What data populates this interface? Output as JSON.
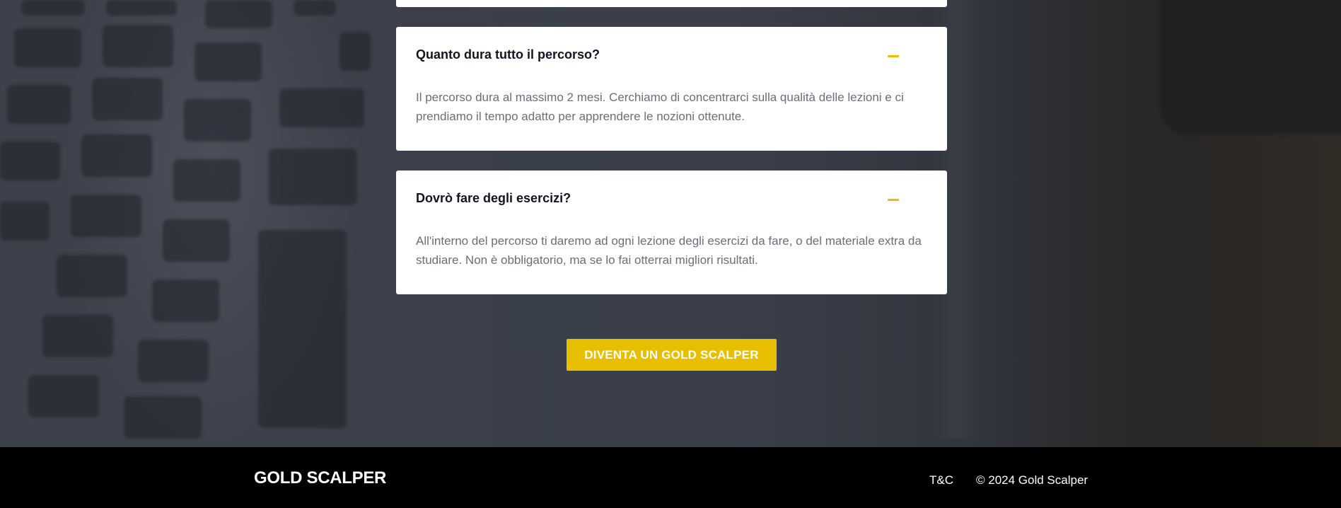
{
  "faq": {
    "items": [
      {
        "question": "Quanto dura tutto il percorso?",
        "answer": "Il percorso dura al massimo 2 mesi. Cerchiamo di concentrarci sulla qualità delle lezioni e ci prendiamo il tempo adatto per apprendere le nozioni ottenute.",
        "expanded": true
      },
      {
        "question": "Dovrò fare degli esercizi?",
        "answer": "All'interno del percorso ti daremo ad ogni lezione degli esercizi da fare, o del materiale extra da studiare. Non è obbligatorio, ma se lo fai otterrai migliori risultati.",
        "expanded": true
      }
    ],
    "toggle_icon": "minus-icon"
  },
  "cta": {
    "label": "DIVENTA UN GOLD SCALPER"
  },
  "footer": {
    "brand": "GOLD SCALPER",
    "terms_link": "T&C",
    "copyright": "© 2024 Gold Scalper"
  },
  "colors": {
    "accent": "#e8bf00",
    "footer_bg": "#000000",
    "question_text": "#101521",
    "answer_text": "#6a6e76"
  }
}
